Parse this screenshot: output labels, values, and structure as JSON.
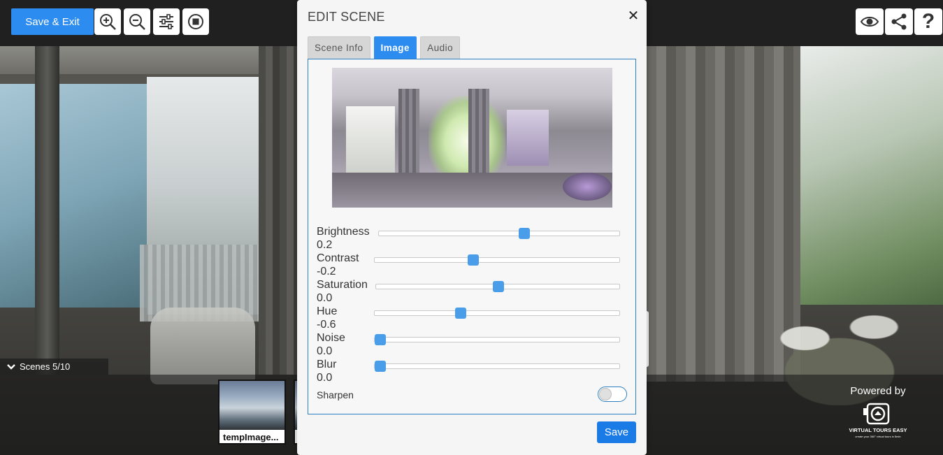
{
  "toolbar": {
    "save_exit_label": "Save & Exit",
    "tools": [
      "zoom-in-icon",
      "zoom-out-icon",
      "sliders-icon",
      "stop-icon"
    ],
    "right_tools": [
      "eye-icon",
      "share-icon",
      "help-icon"
    ],
    "help_glyph": "?"
  },
  "scenes": {
    "label": "Scenes 5/10",
    "thumbnails": [
      {
        "caption": "tempImage..."
      }
    ]
  },
  "powered_by": {
    "text": "Powered by",
    "logo_line1": "VIRTUAL TOURS EASY",
    "logo_line2": "create your 360° virtual tours in 5min"
  },
  "modal": {
    "title": "EDIT SCENE",
    "close_glyph": "✕",
    "tabs": [
      {
        "label": "Scene Info",
        "active": false
      },
      {
        "label": "Image",
        "active": true
      },
      {
        "label": "Audio",
        "active": false
      }
    ],
    "sliders": [
      {
        "label": "Brightness",
        "value": "0.2",
        "fraction": 0.6
      },
      {
        "label": "Contrast",
        "value": "-0.2",
        "fraction": 0.4
      },
      {
        "label": "Saturation",
        "value": "0.0",
        "fraction": 0.5
      },
      {
        "label": "Hue",
        "value": "-0.6",
        "fraction": 0.35
      },
      {
        "label": "Noise",
        "value": "0.0",
        "fraction": 0.0
      },
      {
        "label": "Blur",
        "value": "0.0",
        "fraction": 0.0
      }
    ],
    "sharpen_label": "Sharpen",
    "sharpen_on": false,
    "save_label": "Save"
  },
  "colors": {
    "accent": "#2d8cf0",
    "slider_thumb": "#4a9de8"
  }
}
